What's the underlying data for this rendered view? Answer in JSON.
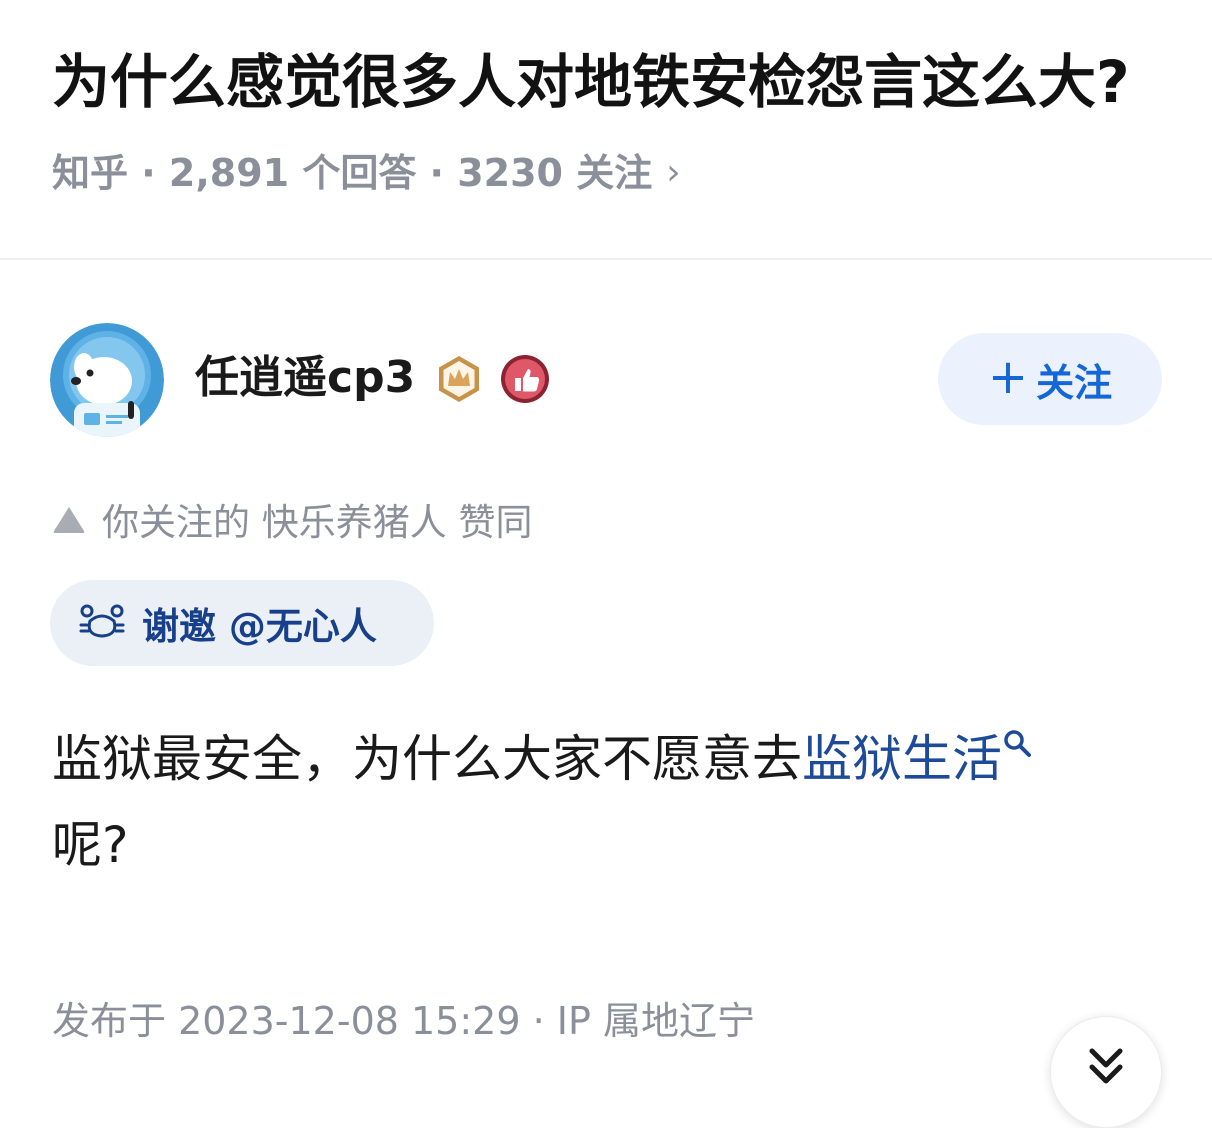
{
  "question": {
    "title": "为什么感觉很多人对地铁安检怨言这么大?",
    "meta": "知乎 · 2,891 个回答 · 3230 关注",
    "meta_chevron": "›"
  },
  "author": {
    "name": "任逍遥cp3",
    "follow_label": "关注",
    "follow_plus": "+"
  },
  "upvote_notice": "你关注的 快乐养猪人 赞同",
  "invite": {
    "label": "谢邀 @无心人"
  },
  "answer": {
    "text_before": "监狱最安全，为什么大家不愿意去",
    "link_text": "监狱生活",
    "text_after": "呢?"
  },
  "publish_info": "发布于 2023-12-08 15:29 · IP 属地辽宁",
  "icons": {
    "avatar": "dog-astronaut-avatar",
    "badge1": "crown-badge-icon",
    "badge2": "thumbs-up-badge-icon",
    "expand": "double-chevron-down-icon"
  },
  "colors": {
    "accent": "#1566d6",
    "link": "#1e4a9a",
    "muted": "#8a8f99",
    "chip_bg": "#ebf2fd"
  }
}
